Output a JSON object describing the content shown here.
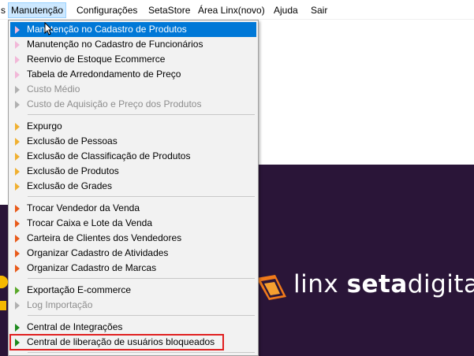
{
  "menubar": {
    "items": [
      {
        "label": "s"
      },
      {
        "label": "Manutenção"
      },
      {
        "label": "Configurações"
      },
      {
        "label": "SetaStore"
      },
      {
        "label": "Área Linx(novo)"
      },
      {
        "label": "Ajuda"
      },
      {
        "label": "Sair"
      }
    ]
  },
  "menu": {
    "items": [
      {
        "label": "Manutenção no Cadastro de Produtos",
        "color": "#f2b8d8"
      },
      {
        "label": "Manutenção no Cadastro de Funcionários",
        "color": "#f2b8d8"
      },
      {
        "label": "Reenvio de Estoque Ecommerce",
        "color": "#f2b8d8"
      },
      {
        "label": "Tabela de Arredondamento de Preço",
        "color": "#f2b8d8"
      },
      {
        "label": "Custo Médio",
        "color": "#a0a0a0"
      },
      {
        "label": "Custo de Aquisição e Preço dos Produtos",
        "color": "#a0a0a0"
      },
      {
        "label": "Expurgo",
        "color": "#f0b030"
      },
      {
        "label": "Exclusão de Pessoas",
        "color": "#f0b030"
      },
      {
        "label": "Exclusão de Classificação de Produtos",
        "color": "#f0b030"
      },
      {
        "label": "Exclusão de Produtos",
        "color": "#f0b030"
      },
      {
        "label": "Exclusão de Grades",
        "color": "#f0b030"
      },
      {
        "label": "Trocar Vendedor da Venda",
        "color": "#e85a1a"
      },
      {
        "label": "Trocar Caixa e Lote da Venda",
        "color": "#e85a1a"
      },
      {
        "label": "Carteira de Clientes dos Vendedores",
        "color": "#e85a1a"
      },
      {
        "label": "Organizar Cadastro de Atividades",
        "color": "#e85a1a"
      },
      {
        "label": "Organizar Cadastro de Marcas",
        "color": "#e85a1a"
      },
      {
        "label": "Exportação E-commerce",
        "color": "#5aa82a"
      },
      {
        "label": "Log Importação",
        "color": "#a0a0a0"
      },
      {
        "label": "Central de Integrações",
        "color": "#1e8a1e"
      },
      {
        "label": "Central de liberação de usuários bloqueados",
        "color": "#1e8a1e"
      }
    ]
  },
  "branding": {
    "logo_prefix": "linx ",
    "logo_bold": "seta",
    "logo_suffix": "digital"
  },
  "colors": {
    "accent": "#0078d7",
    "banner": "#2a1538",
    "logo_orange": "#f07a1a",
    "highlight_border": "#e02020"
  }
}
